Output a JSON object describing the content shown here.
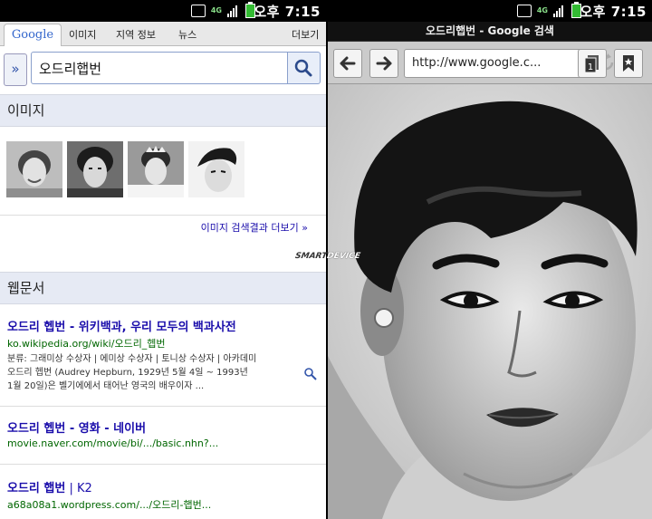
{
  "status": {
    "carrier_tag": "4G",
    "time_prefix": "오후",
    "time": "7:15"
  },
  "left": {
    "tabs": {
      "google": "Google",
      "images": "이미지",
      "local": "지역 정보",
      "news": "뉴스",
      "more": "더보기"
    },
    "search": {
      "expand_label": "»",
      "query": "오드리햅번"
    },
    "images_section": {
      "title": "이미지",
      "more_link": "이미지 검색결과 더보기 »"
    },
    "web_section": {
      "title": "웹문서"
    },
    "results": [
      {
        "title_main": "오드리 헵번",
        "title_rest": " - 위키백과, 우리 모두의 백과사전",
        "url": "ko.wikipedia.org/wiki/오드리_헵번",
        "snippet1": "분류: 그래미상 수상자 | 에미상 수상자 | 토니상 수상자 | 아카데미",
        "snippet2": "오드리 헵번 (Audrey Hepburn, 1929년 5월 4일 ~ 1993년",
        "snippet3": "1월 20일)은 벨기에에서 태어난 영국의 배우이자 ..."
      },
      {
        "title_main": "오드리 헵번",
        "title_rest": " - 영화 - 네이버",
        "url": "movie.naver.com/movie/bi/.../basic.nhn?..."
      },
      {
        "title_main": "오드리 햅번",
        "title_rest": " | K2",
        "url": "a68a08a1.wordpress.com/.../오드리-햅번..."
      }
    ]
  },
  "right": {
    "window_title": "오드리햅번 - Google 검색",
    "url": "http://www.google.c...",
    "tab_count": "1"
  },
  "watermark": {
    "part1": "SMART",
    "part2": "DEVICE"
  },
  "colors": {
    "link": "#1a0dab",
    "url_green": "#006600",
    "section_bg": "#e6eaf4"
  }
}
